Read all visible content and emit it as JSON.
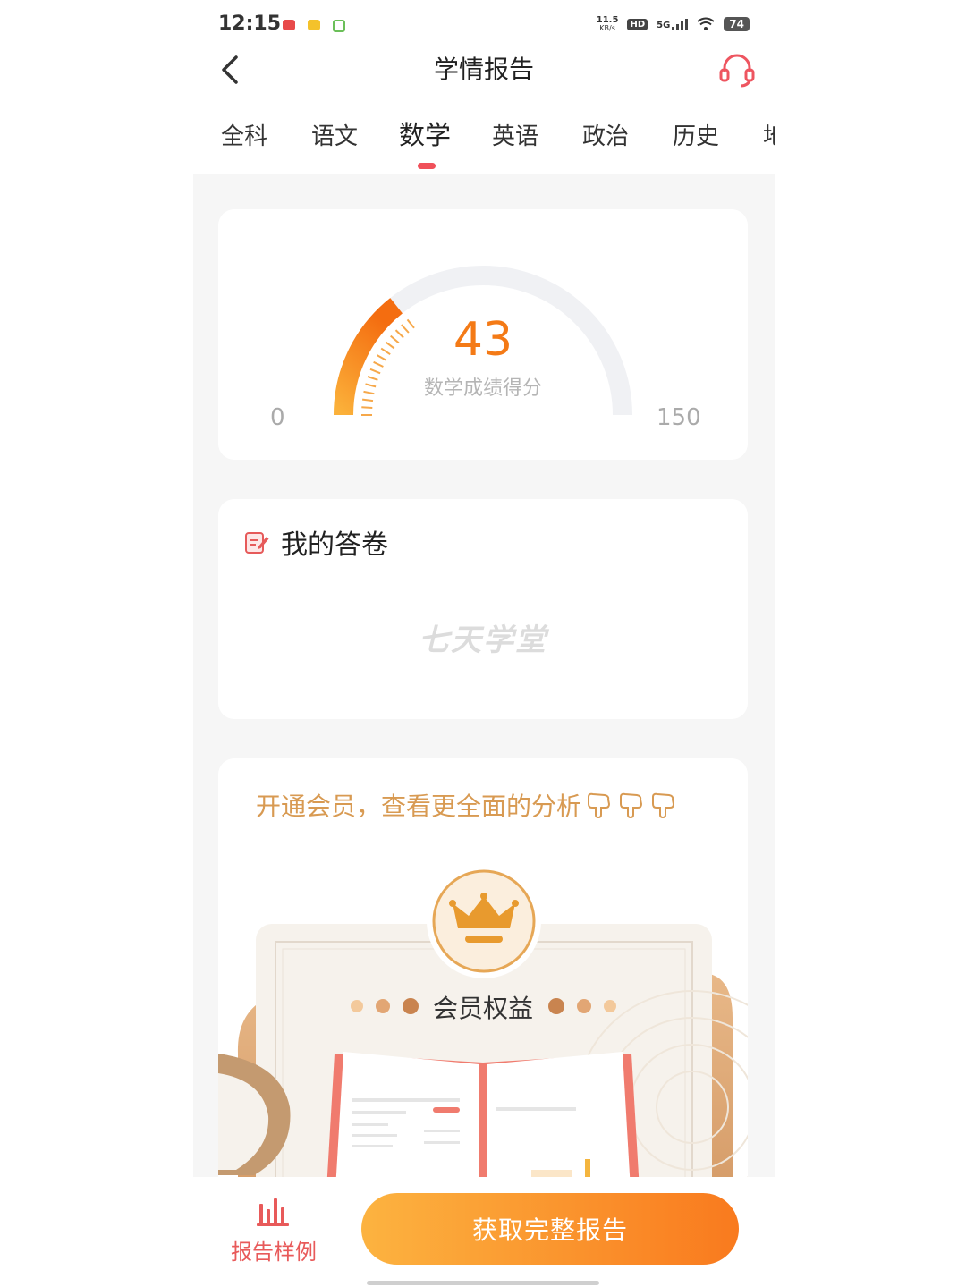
{
  "status": {
    "time": "12:15",
    "speed_top": "11.5",
    "speed_bottom": "KB/s",
    "hd": "HD",
    "net": "5G",
    "battery": "74"
  },
  "nav": {
    "title": "学情报告"
  },
  "tabs": [
    {
      "label": "全科"
    },
    {
      "label": "语文"
    },
    {
      "label": "数学"
    },
    {
      "label": "英语"
    },
    {
      "label": "政治"
    },
    {
      "label": "历史"
    },
    {
      "label": "地"
    }
  ],
  "active_tab": "数学",
  "score_card": {
    "score": "43",
    "label": "数学成绩得分",
    "min": "0",
    "max": "150",
    "score_value": 43,
    "score_max": 150
  },
  "answer_card": {
    "title": "我的答卷",
    "watermark": "七天学堂"
  },
  "member_card": {
    "promo": "开通会员，查看更全面的分析",
    "benefits_label": "会员权益"
  },
  "bottom": {
    "sample_label": "报告样例",
    "cta_label": "获取完整报告"
  },
  "colors": {
    "accent": "#f47a16",
    "tab_indicator": "#f0505a",
    "promo_text": "#d89a52",
    "sample_red": "#e85a5a"
  }
}
